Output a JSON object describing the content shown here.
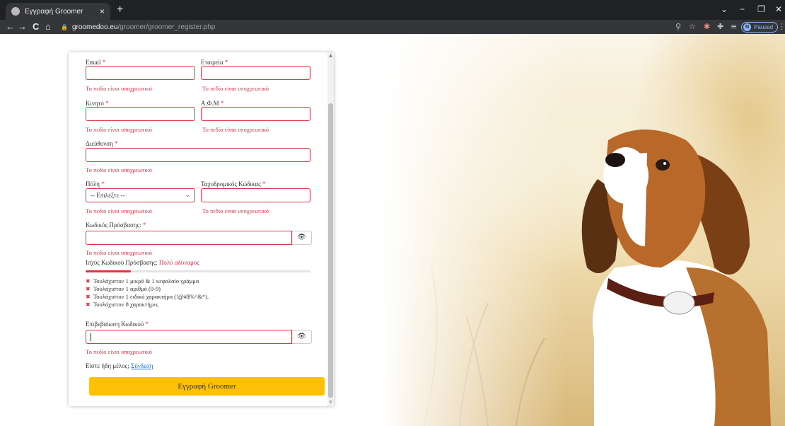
{
  "browser": {
    "tab_title": "Εγγραφή Groomer",
    "tab_close": "×",
    "new_tab": "+",
    "url_domain": "groomedoo.eu",
    "url_path": "/groomer/groomer_register.php",
    "profile_initial": "N",
    "profile_status": "Paused",
    "back": "←",
    "forward": "→",
    "reload": "C",
    "home": "⌂",
    "lock": "🔒",
    "zoom_icon": "⚲",
    "star_icon": "☆",
    "ext_icon": "✱",
    "puzzle_icon": "✚",
    "queue_icon": "≡",
    "menu_icon": "⋮",
    "chevron": "⌄",
    "minimize": "−",
    "restore": "❐",
    "close": "✕"
  },
  "form": {
    "required_mark": "*",
    "email_label": "Email",
    "company_label": "Εταιρεία",
    "mobile_label": "Κινητό",
    "vat_label": "Α.Φ.Μ",
    "address_label": "Διεύθυνση",
    "city_label": "Πόλη",
    "city_selected": "-- Επιλέξτε --",
    "postal_label": "Ταχυδρομικός Κώδικας",
    "password_label": "Κωδικός Πρόσβασης:",
    "confirm_label": "Επιβεβαίωση Κωδικού",
    "required_error": "Το πεδίο είναι υποχρεωτικό",
    "eye_icon": "👁",
    "select_chevron": "⌄",
    "strength_label": "Ισχύς Κωδικού Πρόσβασης:",
    "strength_value": "Πολύ αδύναμος",
    "strength_fraction": 0.2,
    "requirements": [
      "Τουλάχιστον 1 μικρό & 1 κεφαλαίο γράμμα",
      "Τουλάχιστον 1 αριθμό (0-9)",
      "Τουλάχιστον 1 ειδικό χαρακτήρα (!@#$%^&*).",
      "Τουλάχιστον 8 χαρακτήρες"
    ],
    "fail_icon": "✖",
    "member_text": "Είστε ήδη μέλος;",
    "login_link": "Σύνδεση",
    "submit_label": "Εγγραφή Groomer"
  },
  "colors": {
    "error": "#dc3545",
    "submit": "#ffc107",
    "link": "#0d6efd"
  }
}
